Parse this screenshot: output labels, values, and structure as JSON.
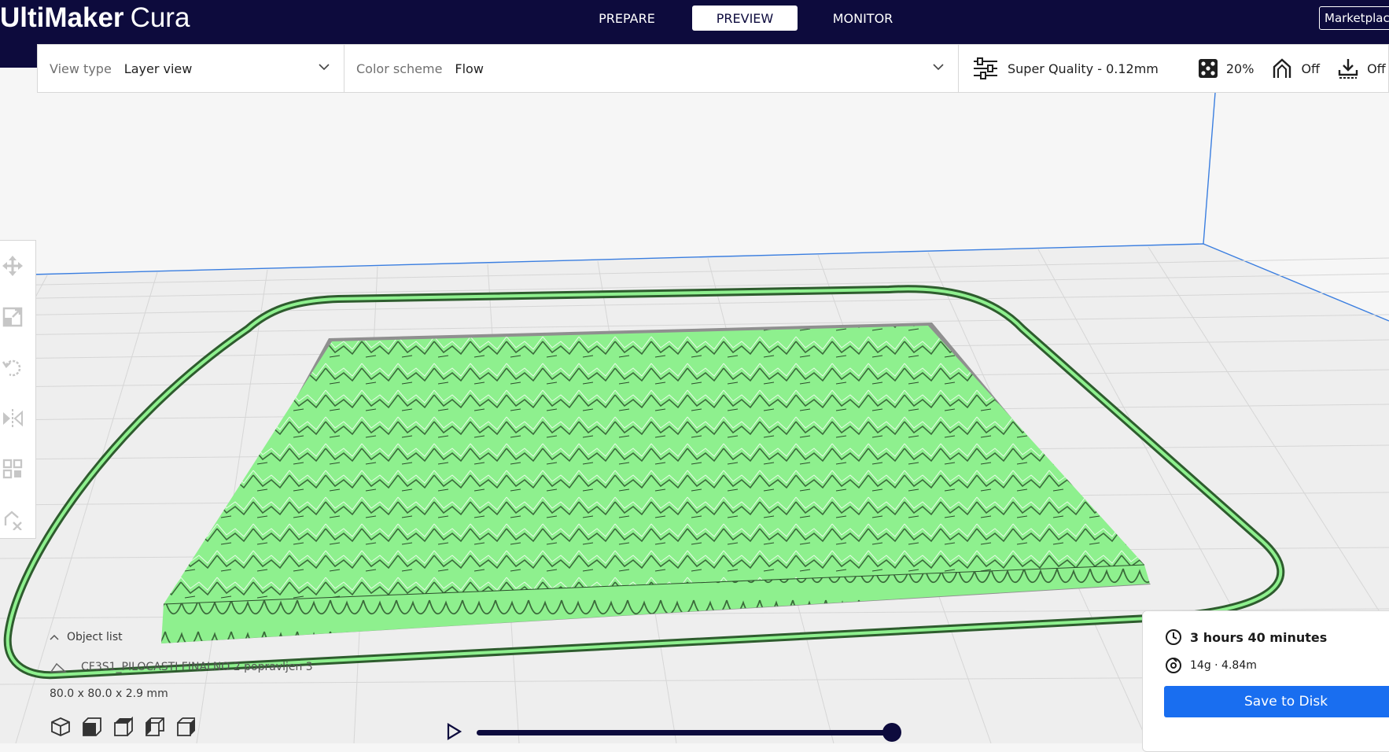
{
  "header": {
    "logo_brand": "UltiMaker",
    "logo_product": "Cura",
    "tabs": [
      {
        "label": "PREPARE",
        "active": false
      },
      {
        "label": "PREVIEW",
        "active": true
      },
      {
        "label": "MONITOR",
        "active": false
      }
    ],
    "marketplace_label": "Marketplace"
  },
  "toolbar": {
    "view_type_label": "View type",
    "view_type_value": "Layer view",
    "color_scheme_label": "Color scheme",
    "color_scheme_value": "Flow",
    "profile": "Super Quality - 0.12mm",
    "infill": "20%",
    "support": "Off",
    "adhesion": "Off"
  },
  "object_list": {
    "label": "Object list",
    "object_name": "CF3S1_PILOCASTI FINALNO 2 popravljen 3",
    "dimensions": "80.0 x 80.0 x 2.9 mm"
  },
  "print_panel": {
    "time": "3 hours 40 minutes",
    "material": "14g · 4.84m",
    "save_label": "Save to Disk"
  },
  "colors": {
    "header_bg": "#0d0b3d",
    "accent_blue": "#196ef0",
    "model_green": "#8ef08e"
  },
  "icons": [
    "move-icon",
    "scale-icon",
    "rotate-icon",
    "mirror-icon",
    "per-model-settings-icon",
    "support-blocker-icon",
    "play-icon",
    "clock-icon",
    "spool-icon",
    "settings-sliders-icon",
    "infill-icon",
    "support-icon",
    "adhesion-icon"
  ]
}
